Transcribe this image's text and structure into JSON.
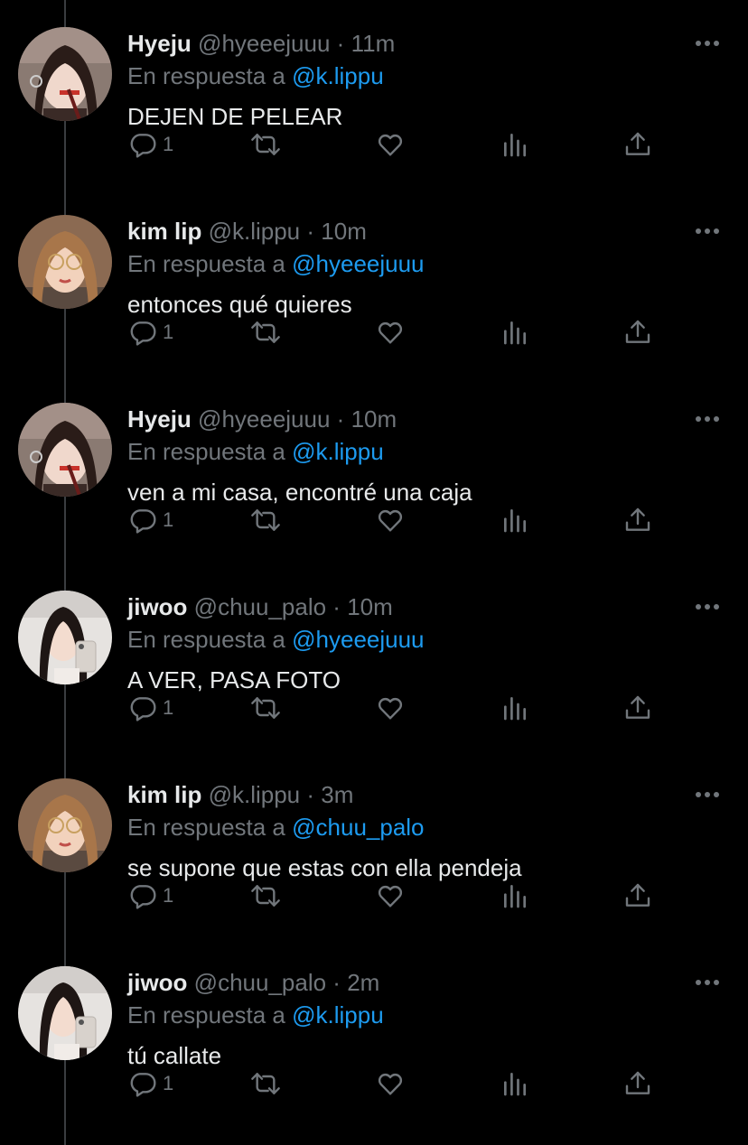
{
  "reply_prefix": "En respuesta a",
  "tweets": [
    {
      "name": "Hyeju",
      "handle": "@hyeeejuuu",
      "sep": "·",
      "time": "11m",
      "reply_to": "@k.lippu",
      "text": "DEJEN DE PELEAR",
      "reply_count": "1",
      "avatar": "hyeju"
    },
    {
      "name": "kim lip",
      "handle": "@k.lippu",
      "sep": "·",
      "time": "10m",
      "reply_to": "@hyeeejuuu",
      "text": "entonces qué quieres",
      "reply_count": "1",
      "avatar": "kimlip"
    },
    {
      "name": "Hyeju",
      "handle": "@hyeeejuuu",
      "sep": "·",
      "time": "10m",
      "reply_to": "@k.lippu",
      "text": "ven a mi casa, encontré una caja",
      "reply_count": "1",
      "avatar": "hyeju"
    },
    {
      "name": "jiwoo",
      "handle": "@chuu_palo",
      "sep": "·",
      "time": "10m",
      "reply_to": "@hyeeejuuu",
      "text": "A VER, PASA FOTO",
      "reply_count": "1",
      "avatar": "jiwoo"
    },
    {
      "name": "kim lip",
      "handle": "@k.lippu",
      "sep": "·",
      "time": "3m",
      "reply_to": "@chuu_palo",
      "text": "se supone que estas con ella pendeja",
      "reply_count": "1",
      "avatar": "kimlip"
    },
    {
      "name": "jiwoo",
      "handle": "@chuu_palo",
      "sep": "·",
      "time": "2m",
      "reply_to": "@k.lippu",
      "text": "tú callate",
      "reply_count": "1",
      "avatar": "jiwoo"
    }
  ],
  "colors": {
    "background": "#000000",
    "primary_text": "#e7e9ea",
    "secondary_text": "#71767b",
    "mention": "#1d9bf0",
    "thread_line": "#3a3d40"
  },
  "icons": [
    "reply-icon",
    "retweet-icon",
    "like-icon",
    "analytics-icon",
    "share-icon",
    "more-icon"
  ]
}
